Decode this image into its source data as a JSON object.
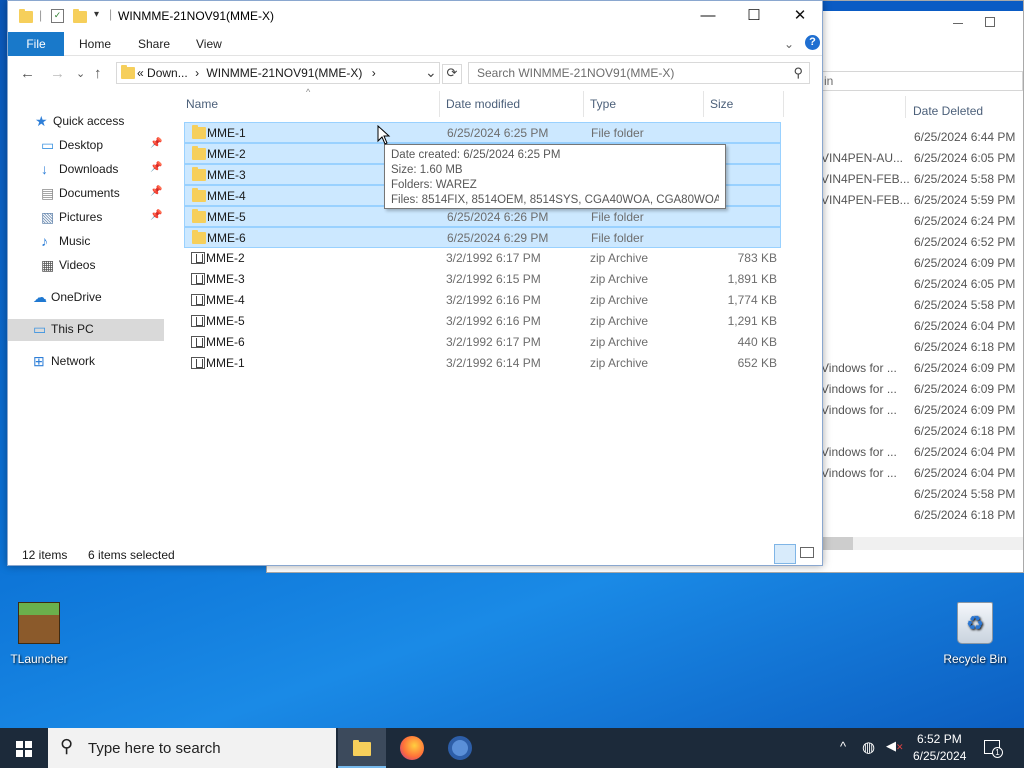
{
  "window": {
    "title": "WINMME-21NOV91(MME-X)",
    "min": "—",
    "max": "☐",
    "close": "✕"
  },
  "ribbon": {
    "file": "File",
    "home": "Home",
    "share": "Share",
    "view": "View",
    "expand": "⌄",
    "help": "?"
  },
  "nav": {
    "back": "←",
    "forward": "→",
    "recent": "⌄",
    "up": "↑",
    "refresh": "⟳",
    "dropdown": "⌄",
    "address_parts": [
      "«",
      "Down...",
      "›",
      "WINMME-21NOV91(MME-X)",
      "›"
    ],
    "search_placeholder": "Search WINMME-21NOV91(MME-X)"
  },
  "sidebar": [
    {
      "label": "Quick access",
      "icon": "star-icon",
      "pinned": false
    },
    {
      "label": "Desktop",
      "icon": "desktop-icon",
      "pinned": true
    },
    {
      "label": "Downloads",
      "icon": "download-icon",
      "pinned": true
    },
    {
      "label": "Documents",
      "icon": "document-icon",
      "pinned": true
    },
    {
      "label": "Pictures",
      "icon": "pictures-icon",
      "pinned": true
    },
    {
      "label": "Music",
      "icon": "music-icon",
      "pinned": false
    },
    {
      "label": "Videos",
      "icon": "video-icon",
      "pinned": false
    },
    {
      "label": "OneDrive",
      "icon": "cloud-icon",
      "pinned": false
    },
    {
      "label": "This PC",
      "icon": "computer-icon",
      "pinned": false,
      "selected": true
    },
    {
      "label": "Network",
      "icon": "network-icon",
      "pinned": false
    }
  ],
  "columns": {
    "name": "Name",
    "date": "Date modified",
    "type": "Type",
    "size": "Size"
  },
  "files": [
    {
      "name": "MME-1",
      "date": "6/25/2024 6:25 PM",
      "type": "File folder",
      "size": "",
      "kind": "folder",
      "selected": true
    },
    {
      "name": "MME-2",
      "date": "",
      "type": "",
      "size": "",
      "kind": "folder",
      "selected": true
    },
    {
      "name": "MME-3",
      "date": "",
      "type": "",
      "size": "",
      "kind": "folder",
      "selected": true
    },
    {
      "name": "MME-4",
      "date": "",
      "type": "",
      "size": "",
      "kind": "folder",
      "selected": true
    },
    {
      "name": "MME-5",
      "date": "6/25/2024 6:26 PM",
      "type": "File folder",
      "size": "",
      "kind": "folder",
      "selected": true
    },
    {
      "name": "MME-6",
      "date": "6/25/2024 6:29 PM",
      "type": "File folder",
      "size": "",
      "kind": "folder",
      "selected": true
    },
    {
      "name": "MME-2",
      "date": "3/2/1992 6:17 PM",
      "type": "zip Archive",
      "size": "783 KB",
      "kind": "zip",
      "selected": false
    },
    {
      "name": "MME-3",
      "date": "3/2/1992 6:15 PM",
      "type": "zip Archive",
      "size": "1,891 KB",
      "kind": "zip",
      "selected": false
    },
    {
      "name": "MME-4",
      "date": "3/2/1992 6:16 PM",
      "type": "zip Archive",
      "size": "1,774 KB",
      "kind": "zip",
      "selected": false
    },
    {
      "name": "MME-5",
      "date": "3/2/1992 6:16 PM",
      "type": "zip Archive",
      "size": "1,291 KB",
      "kind": "zip",
      "selected": false
    },
    {
      "name": "MME-6",
      "date": "3/2/1992 6:17 PM",
      "type": "zip Archive",
      "size": "440 KB",
      "kind": "zip",
      "selected": false
    },
    {
      "name": "MME-1",
      "date": "3/2/1992 6:14 PM",
      "type": "zip Archive",
      "size": "652 KB",
      "kind": "zip",
      "selected": false
    }
  ],
  "tooltip": {
    "created": "Date created: 6/25/2024 6:25 PM",
    "size": "Size: 1.60 MB",
    "folders": "Folders: WAREZ",
    "files": "Files: 8514FIX, 8514OEM, 8514SYS, CGA40WOA, CGA80WOA, ..."
  },
  "status": {
    "items": "12 items",
    "selected": "6 items selected"
  },
  "background_window": {
    "search_fragment": "in",
    "date_header": "Date Deleted",
    "rows": [
      {
        "name": "",
        "date": "6/25/2024 6:44 PM"
      },
      {
        "name": "VIN4PEN-AU...",
        "date": "6/25/2024 6:05 PM"
      },
      {
        "name": "VIN4PEN-FEB...",
        "date": "6/25/2024 5:58 PM"
      },
      {
        "name": "VIN4PEN-FEB...",
        "date": "6/25/2024 5:59 PM"
      },
      {
        "name": "",
        "date": "6/25/2024 6:24 PM"
      },
      {
        "name": "",
        "date": "6/25/2024 6:52 PM"
      },
      {
        "name": "",
        "date": "6/25/2024 6:09 PM"
      },
      {
        "name": "",
        "date": "6/25/2024 6:05 PM"
      },
      {
        "name": "",
        "date": "6/25/2024 5:58 PM"
      },
      {
        "name": "",
        "date": "6/25/2024 6:04 PM"
      },
      {
        "name": "",
        "date": "6/25/2024 6:18 PM"
      },
      {
        "name": "Vindows for ...",
        "date": "6/25/2024 6:09 PM"
      },
      {
        "name": "Vindows for ...",
        "date": "6/25/2024 6:09 PM"
      },
      {
        "name": "Vindows for ...",
        "date": "6/25/2024 6:09 PM"
      },
      {
        "name": "",
        "date": "6/25/2024 6:18 PM"
      },
      {
        "name": "Vindows for ...",
        "date": "6/25/2024 6:04 PM"
      },
      {
        "name": "Vindows for ...",
        "date": "6/25/2024 6:04 PM"
      },
      {
        "name": "",
        "date": "6/25/2024 5:58 PM"
      },
      {
        "name": "",
        "date": "6/25/2024 6:18 PM"
      }
    ]
  },
  "desktop": {
    "tlauncher": "TLauncher",
    "recycle": "Recycle Bin"
  },
  "taskbar": {
    "search": "Type here to search",
    "time": "6:52 PM",
    "date": "6/25/2024",
    "notif_count": "1"
  },
  "colors": {
    "accent": "#1979ca",
    "selection": "#cce8ff",
    "taskbar": "#1c2a3a"
  }
}
